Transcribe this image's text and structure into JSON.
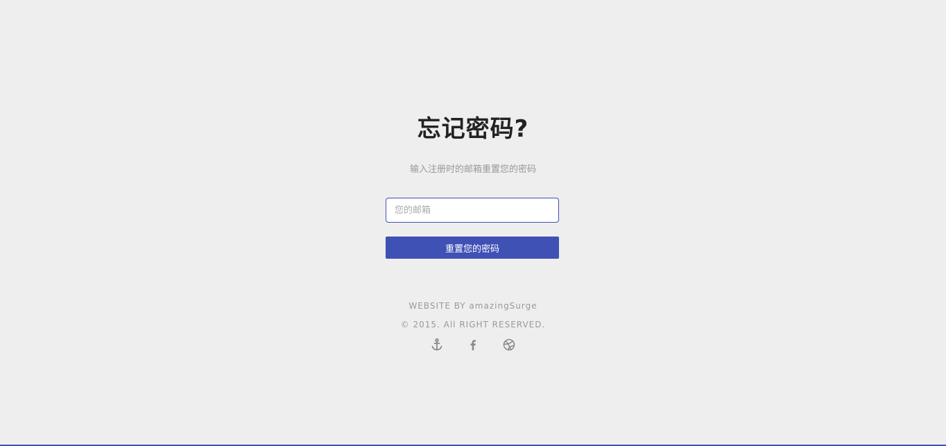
{
  "heading": "忘记密码?",
  "subtitle": "输入注册时的邮箱重置您的密码",
  "form": {
    "email_placeholder": "您的邮箱",
    "email_value": "",
    "submit_label": "重置您的密码"
  },
  "footer": {
    "credit": "WEBSITE BY amazingSurge",
    "copyright": "© 2015. All RIGHT RESERVED.",
    "social_icons": [
      "anchor-icon",
      "facebook-icon",
      "dribbble-icon"
    ]
  },
  "colors": {
    "background": "#eeeeee",
    "accent": "#3f51b5",
    "heading": "#222222",
    "muted_text": "#999999",
    "icon": "#888888"
  }
}
